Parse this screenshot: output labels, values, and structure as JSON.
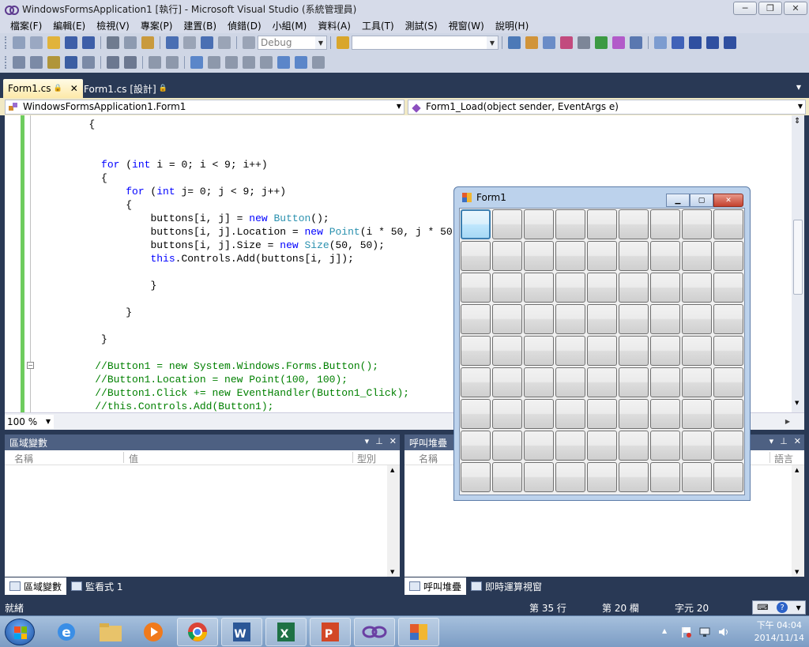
{
  "window": {
    "title": "WindowsFormsApplication1 [執行] - Microsoft Visual Studio (系統管理員)",
    "buttons": [
      "─",
      "❐",
      "✕"
    ]
  },
  "menu": [
    "檔案(F)",
    "編輯(E)",
    "檢視(V)",
    "專案(P)",
    "建置(B)",
    "偵錯(D)",
    "小組(M)",
    "資料(A)",
    "工具(T)",
    "測試(S)",
    "視窗(W)",
    "說明(H)"
  ],
  "toolbar": {
    "config_value": "Debug",
    "search_value": ""
  },
  "tabs": [
    {
      "label": "Form1.cs",
      "active": true
    },
    {
      "label": "Form1.cs [設計]",
      "active": false
    }
  ],
  "nav": {
    "class_combo": "WindowsFormsApplication1.Form1",
    "member_combo": "Form1_Load(object sender, EventArgs e)"
  },
  "code_lines": [
    {
      "indent": "        ",
      "parts": [
        {
          "t": "{",
          "c": ""
        }
      ]
    },
    {
      "indent": "",
      "parts": []
    },
    {
      "indent": "",
      "parts": []
    },
    {
      "indent": "          ",
      "parts": [
        {
          "t": "for",
          "c": "kw"
        },
        {
          "t": " (",
          "c": ""
        },
        {
          "t": "int",
          "c": "kw"
        },
        {
          "t": " i = 0; i < 9; i++)",
          "c": ""
        }
      ]
    },
    {
      "indent": "          ",
      "parts": [
        {
          "t": "{",
          "c": ""
        }
      ]
    },
    {
      "indent": "              ",
      "parts": [
        {
          "t": "for",
          "c": "kw"
        },
        {
          "t": " (",
          "c": ""
        },
        {
          "t": "int",
          "c": "kw"
        },
        {
          "t": " j= 0; j < 9; j++)",
          "c": ""
        }
      ]
    },
    {
      "indent": "              ",
      "parts": [
        {
          "t": "{",
          "c": ""
        }
      ]
    },
    {
      "indent": "                  ",
      "parts": [
        {
          "t": "buttons[i, j] = ",
          "c": ""
        },
        {
          "t": "new",
          "c": "kw"
        },
        {
          "t": " ",
          "c": ""
        },
        {
          "t": "Button",
          "c": "ty"
        },
        {
          "t": "();",
          "c": ""
        }
      ]
    },
    {
      "indent": "                  ",
      "parts": [
        {
          "t": "buttons[i, j].Location = ",
          "c": ""
        },
        {
          "t": "new",
          "c": "kw"
        },
        {
          "t": " ",
          "c": ""
        },
        {
          "t": "Point",
          "c": "ty"
        },
        {
          "t": "(i * 50, j * 50);",
          "c": ""
        }
      ]
    },
    {
      "indent": "                  ",
      "parts": [
        {
          "t": "buttons[i, j].Size = ",
          "c": ""
        },
        {
          "t": "new",
          "c": "kw"
        },
        {
          "t": " ",
          "c": ""
        },
        {
          "t": "Size",
          "c": "ty"
        },
        {
          "t": "(50, 50);",
          "c": ""
        }
      ]
    },
    {
      "indent": "                  ",
      "parts": [
        {
          "t": "this",
          "c": "kw"
        },
        {
          "t": ".Controls.Add(buttons[i, j]);",
          "c": ""
        }
      ]
    },
    {
      "indent": "",
      "parts": []
    },
    {
      "indent": "                  ",
      "parts": [
        {
          "t": "}",
          "c": ""
        }
      ]
    },
    {
      "indent": "",
      "parts": []
    },
    {
      "indent": "              ",
      "parts": [
        {
          "t": "}",
          "c": ""
        }
      ]
    },
    {
      "indent": "",
      "parts": []
    },
    {
      "indent": "          ",
      "parts": [
        {
          "t": "}",
          "c": ""
        }
      ]
    },
    {
      "indent": "",
      "parts": []
    },
    {
      "indent": "         ",
      "parts": [
        {
          "t": "//Button1 = new System.Windows.Forms.Button();",
          "c": "cm"
        }
      ]
    },
    {
      "indent": "         ",
      "parts": [
        {
          "t": "//Button1.Location = new Point(100, 100);",
          "c": "cm"
        }
      ]
    },
    {
      "indent": "         ",
      "parts": [
        {
          "t": "//Button1.Click += new EventHandler(Button1_Click);",
          "c": "cm"
        }
      ]
    },
    {
      "indent": "         ",
      "parts": [
        {
          "t": "//this.Controls.Add(Button1);",
          "c": "cm"
        }
      ]
    }
  ],
  "editor": {
    "zoom": "100 %"
  },
  "locals_panel": {
    "title": "區域變數",
    "col_name": "名稱",
    "col_value": "值",
    "col_type": "型別",
    "tabs": [
      "區域變數",
      "監看式 1"
    ]
  },
  "callstack_panel": {
    "title": "呼叫堆疊",
    "col_name": "名稱",
    "col_lang": "語言",
    "tabs": [
      "呼叫堆疊",
      "即時運算視窗"
    ]
  },
  "statusbar": {
    "ready": "就緒",
    "line": "第 35 行",
    "col": "第 20 欄",
    "ch": "字元 20"
  },
  "form1": {
    "title": "Form1",
    "grid_rows": 9,
    "grid_cols": 9,
    "focused": [
      0,
      0
    ]
  },
  "taskbar": {
    "apps": [
      "windows-explorer",
      "internet-explorer",
      "file-explorer",
      "media-player",
      "chrome",
      "word",
      "excel",
      "powerpoint",
      "visual-studio",
      "form-app"
    ],
    "time": "下午 04:04",
    "date": "2014/11/14"
  }
}
